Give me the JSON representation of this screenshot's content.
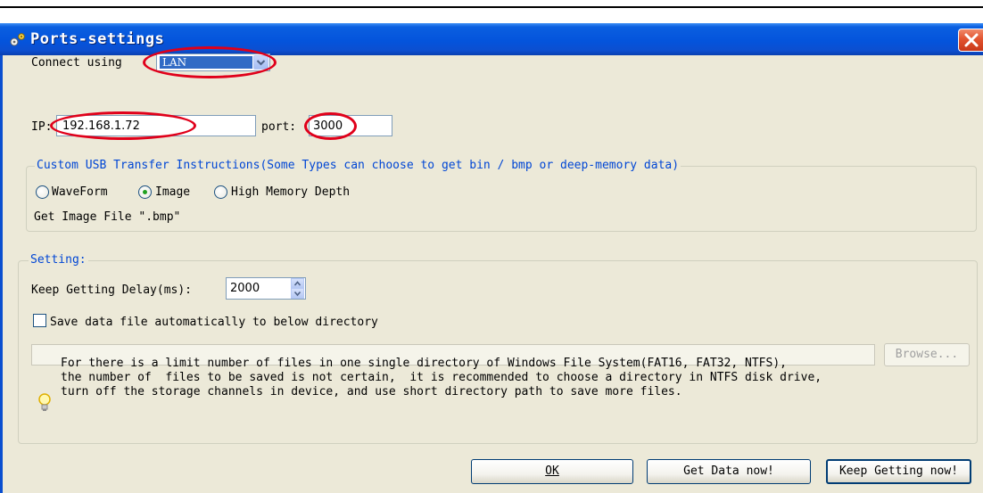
{
  "dialog": {
    "title": "Ports-settings",
    "title_icon": "gears-icon",
    "close_icon": "close-icon"
  },
  "connection": {
    "connect_label": "Connect using",
    "connect_value": "LAN",
    "ip_label": "IP:",
    "ip_value": "192.168.1.72",
    "port_label": "port:",
    "port_value": "3000"
  },
  "usb_group": {
    "legend": "Custom USB Transfer Instructions(Some Types can choose to get bin / bmp or deep-memory data)",
    "options": [
      {
        "label": "WaveForm",
        "selected": false
      },
      {
        "label": "Image",
        "selected": true
      },
      {
        "label": "High Memory Depth",
        "selected": false
      }
    ],
    "file_note": "Get Image File \".bmp\""
  },
  "setting_group": {
    "legend": "Setting:",
    "delay_label": "Keep Getting Delay(ms):",
    "delay_value": "2000",
    "save_label": "Save data file automatically to below directory",
    "save_checked": false,
    "directory_value": "",
    "browse_label": "Browse...",
    "info_icon": "lightbulb-icon",
    "info_lines": [
      "For there is a limit number of files in one single directory of Windows File System(FAT16, FAT32, NTFS),",
      "the number of  files to be saved is not certain,  it is recommended to choose a directory in NTFS disk drive,",
      "turn off the storage channels in device, and use short directory path to save more files."
    ]
  },
  "buttons": {
    "ok": "OK",
    "get_data": "Get Data now!",
    "keep_getting": "Keep Getting now!"
  },
  "colors": {
    "titlebar": "#0454dc",
    "dialog_bg": "#ece9d8",
    "legend_text": "#0046d5",
    "highlight_ellipse": "#e0001a",
    "selection": "#316ac5"
  }
}
